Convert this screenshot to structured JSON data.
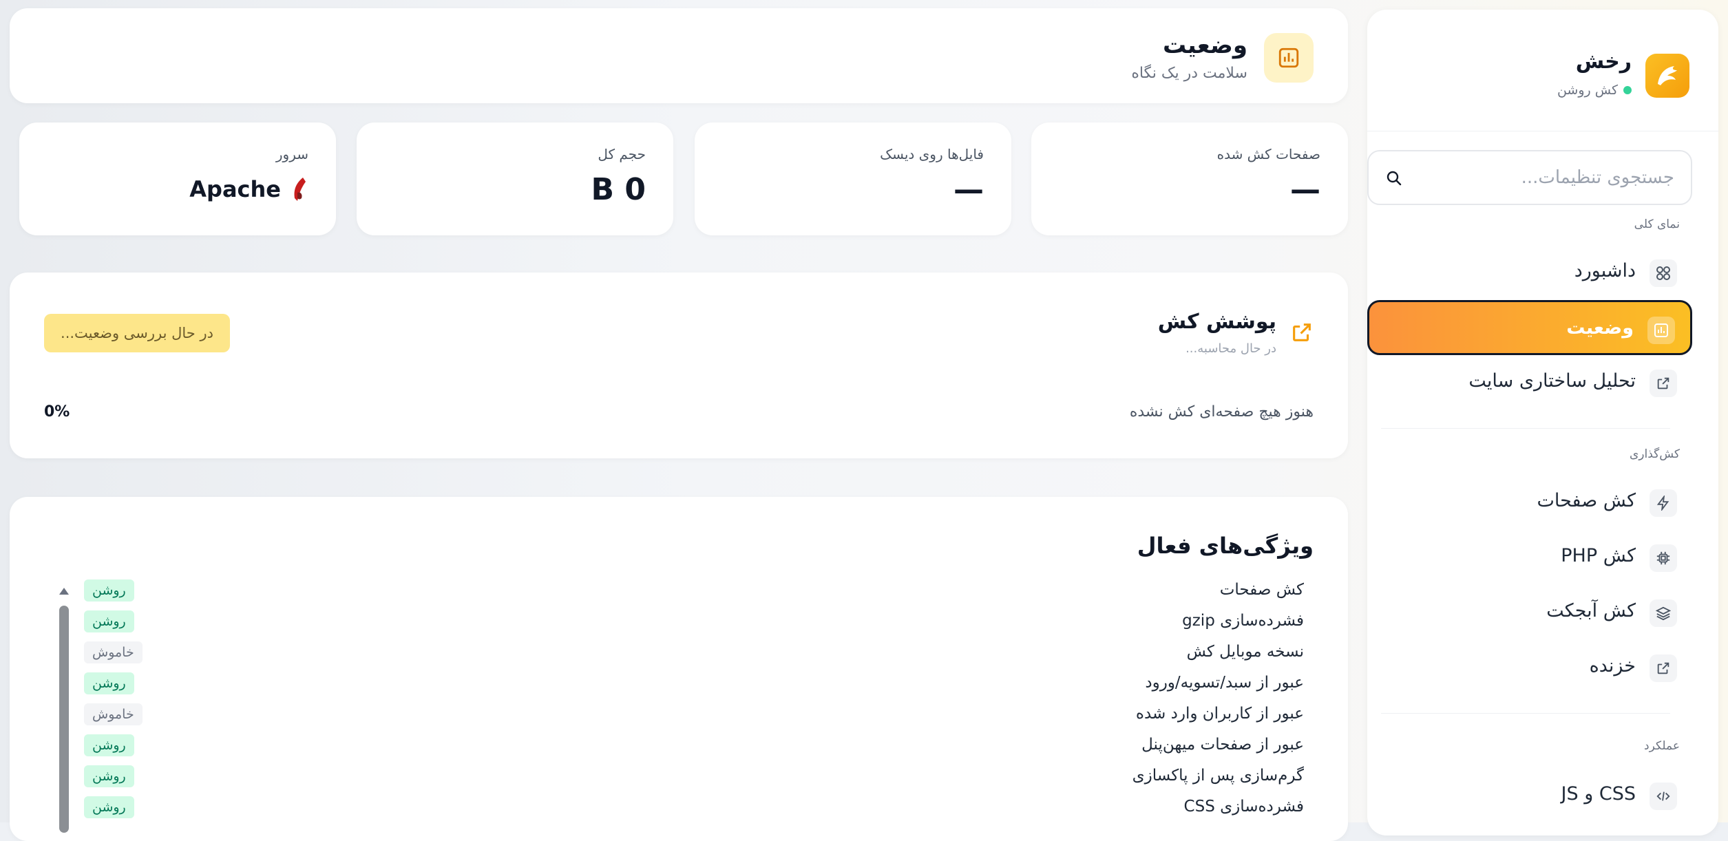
{
  "brand": {
    "name": "رخش",
    "status": "کش روشن"
  },
  "search": {
    "placeholder": "جستجوی تنظیمات..."
  },
  "sidebar": {
    "sections": [
      {
        "label": "نمای کلی",
        "items": [
          {
            "label": "داشبورد",
            "icon": "dashboard-grid-icon"
          },
          {
            "label": "وضعیت",
            "icon": "status-chart-icon",
            "active": true
          },
          {
            "label": "تحلیل ساختاری سایت",
            "icon": "external-link-icon"
          }
        ]
      },
      {
        "label": "کش‌گذاری",
        "items": [
          {
            "label": "کش صفحات",
            "icon": "bolt-icon"
          },
          {
            "label": "کش PHP",
            "icon": "cpu-chip-icon"
          },
          {
            "label": "کش آبجکت",
            "icon": "layers-icon"
          },
          {
            "label": "خزنده",
            "icon": "external-link-icon"
          }
        ]
      },
      {
        "label": "عملکرد",
        "items": [
          {
            "label": "CSS و JS",
            "icon": "code-icon"
          }
        ]
      }
    ]
  },
  "header": {
    "title": "وضعیت",
    "subtitle": "سلامت در یک نگاه"
  },
  "stats": [
    {
      "label": "صفحات کش شده",
      "value": "—"
    },
    {
      "label": "فایل‌ها روی دیسک",
      "value": "—"
    },
    {
      "label": "حجم کل",
      "value": "B 0"
    },
    {
      "label": "سرور",
      "value": "Apache"
    }
  ],
  "coverage": {
    "title": "پوشش کش",
    "subtitle": "در حال محاسبه...",
    "button": "در حال بررسی وضعیت...",
    "note": "هنوز هیچ صفحه‌ای کش نشده",
    "percent": "0%"
  },
  "features": {
    "title": "ویژگی‌های فعال",
    "items": [
      {
        "name": "کش صفحات",
        "state": "روشن",
        "on": true
      },
      {
        "name": "فشرده‌سازی gzip",
        "state": "روشن",
        "on": true
      },
      {
        "name": "نسخه موبایل کش",
        "state": "خاموش",
        "on": false
      },
      {
        "name": "عبور از سبد/تسویه/ورود",
        "state": "روشن",
        "on": true
      },
      {
        "name": "عبور از کاربران وارد شده",
        "state": "خاموش",
        "on": false
      },
      {
        "name": "عبور از صفحات میهن‌پنل",
        "state": "روشن",
        "on": true
      },
      {
        "name": "گرم‌سازی پس از پاکسازی",
        "state": "روشن",
        "on": true
      },
      {
        "name": "فشرده‌سازی CSS",
        "state": "روشن",
        "on": true
      }
    ]
  },
  "colors": {
    "accent": "#fbbf24",
    "accent_dark": "#f59e0b",
    "on_bg": "#d1fae5",
    "on_text": "#047857"
  }
}
